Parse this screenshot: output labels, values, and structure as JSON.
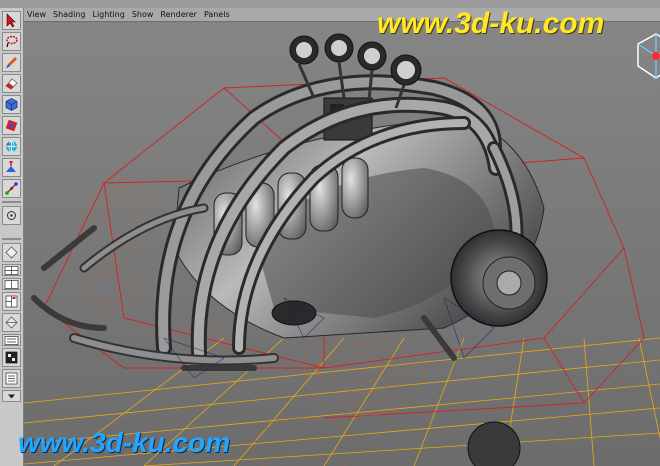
{
  "viewport": {
    "menu": [
      "View",
      "Shading",
      "Lighting",
      "Show",
      "Renderer",
      "Panels"
    ]
  },
  "toolbox": {
    "tools": [
      "select-arrow-icon",
      "lasso-icon",
      "paint-brush-icon",
      "eraser-icon",
      "cube-icon",
      "rotate-icon",
      "globe-icon",
      "scale-icon",
      "manipulator-icon",
      "snap-icon"
    ],
    "layout_buttons": [
      "single-view-icon",
      "four-view-icon",
      "split-view-icon",
      "three-view-icon",
      "persp-graph-icon",
      "outliner-icon",
      "hypershade-icon",
      "channel-icon"
    ]
  },
  "watermark": {
    "top": "www.3d-ku.com",
    "bottom": "www.3d-ku.com"
  },
  "colors": {
    "viewport_bg": "#7a7a7a",
    "ground_grid": "#ffb400",
    "wireframe_bbox": "#d42020",
    "hair_wire": "#c0602a",
    "watermark_top": "#ffe82a",
    "watermark_bottom": "#24a6ff"
  }
}
